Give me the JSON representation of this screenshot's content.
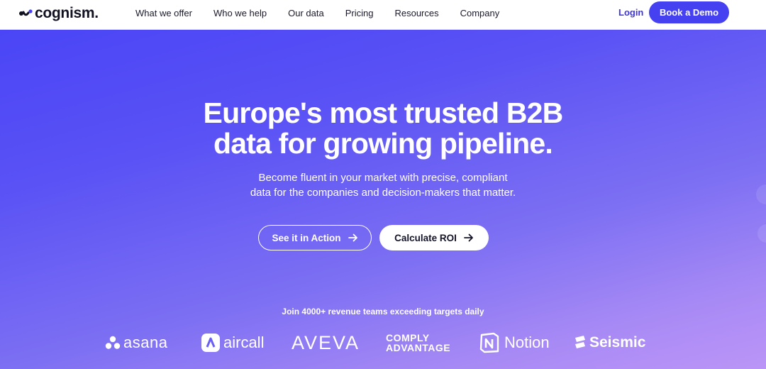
{
  "header": {
    "logo_text": "cognism.",
    "nav": [
      "What we offer",
      "Who we help",
      "Our data",
      "Pricing",
      "Resources",
      "Company"
    ],
    "login": "Login",
    "cta": "Book a Demo"
  },
  "hero": {
    "headline_line1": "Europe's most trusted B2B",
    "headline_line2": "data for growing pipeline.",
    "sub_line1": "Become fluent in your market with precise, compliant",
    "sub_line2": "data for the companies and decision-makers that matter.",
    "button_primary": "See it in Action",
    "button_secondary": "Calculate ROI",
    "arrow_icon": "arrow-right-icon"
  },
  "social_proof": {
    "caption": "Join 4000+ revenue teams exceeding targets daily",
    "logos": [
      "asana",
      "aircall",
      "AVEVA",
      "COMPLY",
      "ADVANTAGE",
      "Notion",
      "Seismic"
    ]
  },
  "colors": {
    "brand": "#4540f0",
    "hero_start": "#4a45f6",
    "hero_end": "#bb95f7",
    "text_dark": "#1a1a2a"
  }
}
